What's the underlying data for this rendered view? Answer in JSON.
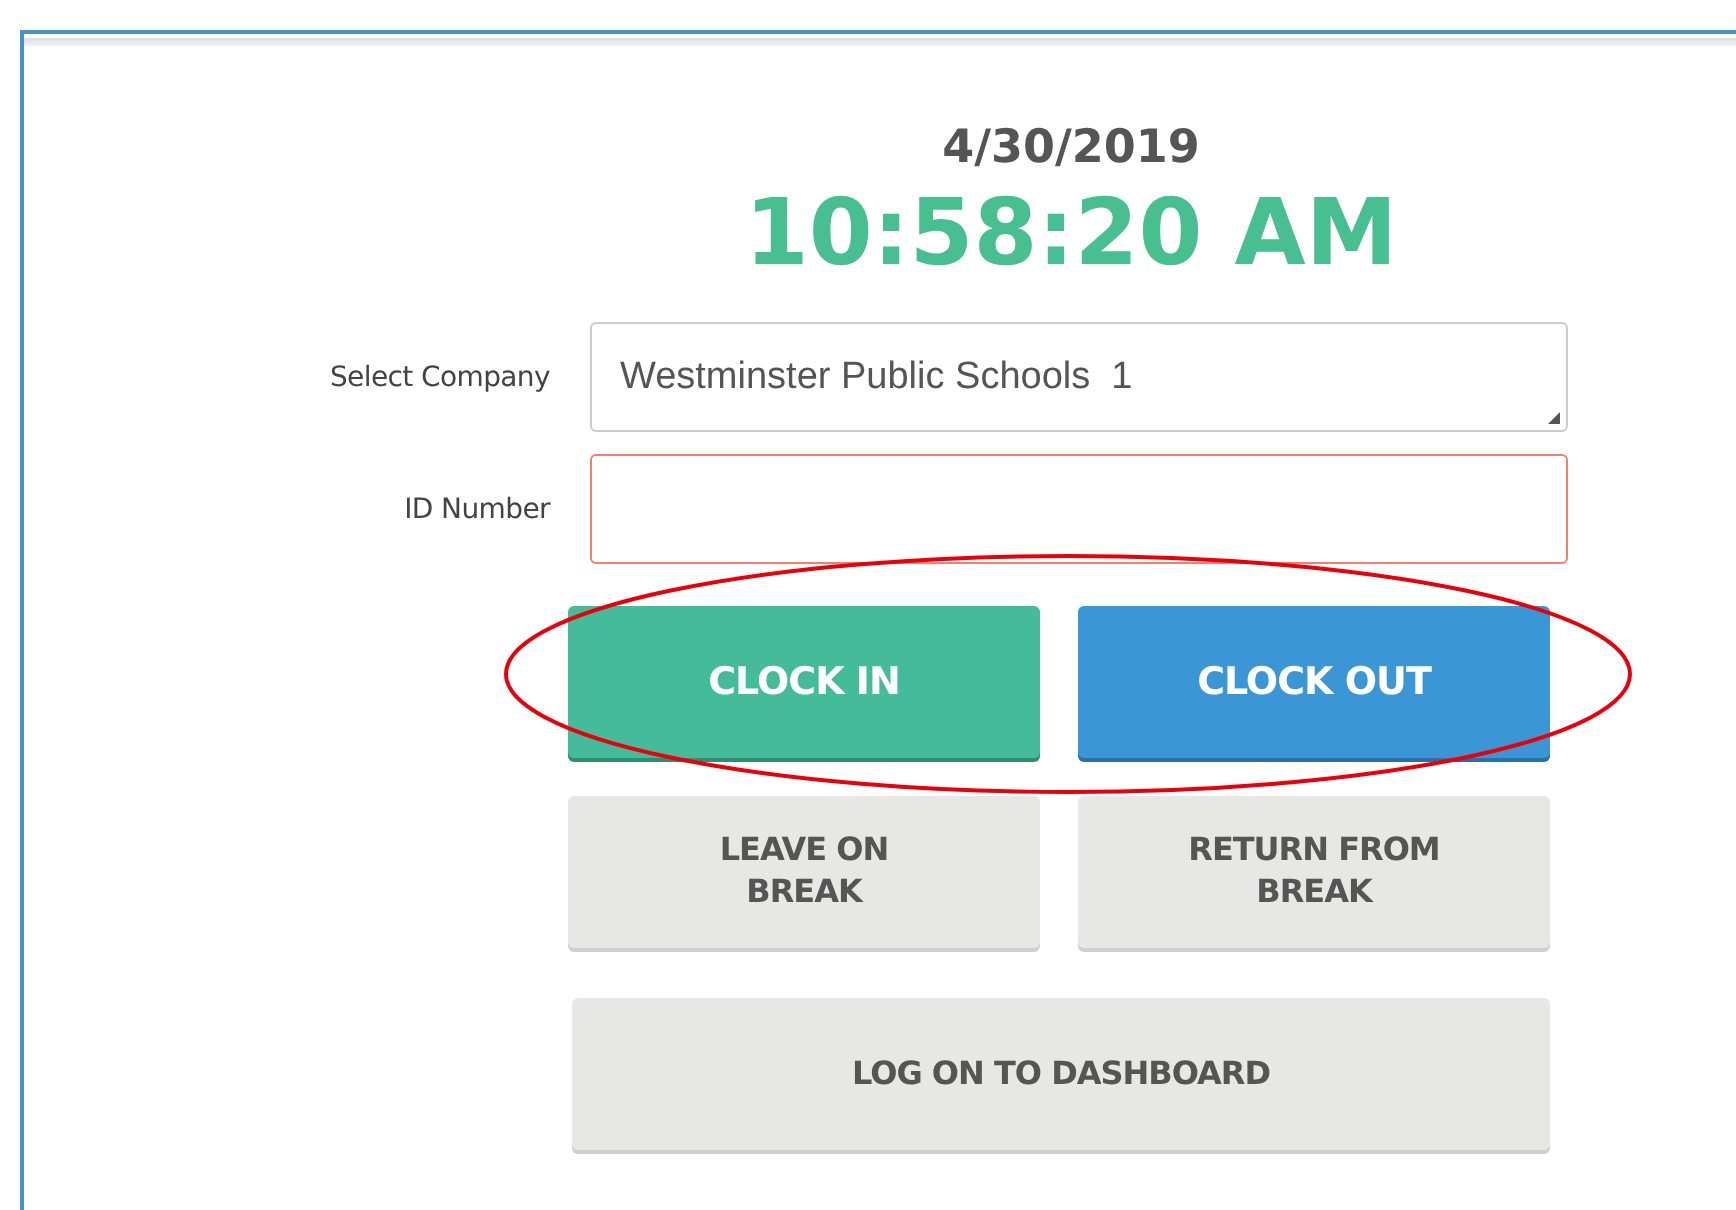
{
  "date": "4/30/2019",
  "time": "10:58:20 AM",
  "fields": [
    {
      "kind": "select",
      "label": "Select Company",
      "value": "Westminster Public Schools  1",
      "invalid": false
    },
    {
      "kind": "text",
      "label": "ID Number",
      "invalid": true
    }
  ],
  "buttons": [
    {
      "label": "CLOCK IN",
      "kind": "success"
    },
    {
      "label": "CLOCK OUT",
      "kind": "primary"
    },
    {
      "label": "LEAVE ON\nBREAK",
      "kind": "default"
    },
    {
      "label": "RETURN FROM\nBREAK",
      "kind": "default"
    }
  ],
  "wide_button": {
    "label": "LOG ON TO DASHBOARD",
    "kind": "default"
  },
  "annotation": {
    "kind": "ellipse",
    "color": "#e8000b"
  }
}
